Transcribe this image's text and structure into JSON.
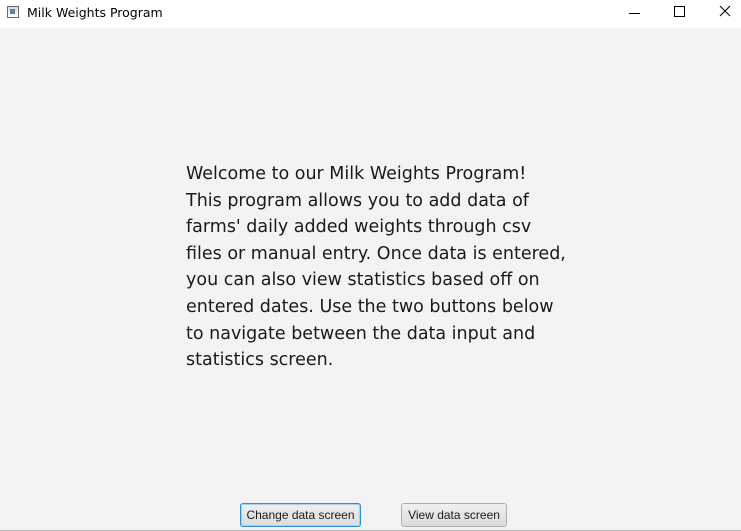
{
  "window": {
    "title": "Milk Weights Program",
    "icons": {
      "app": "app-window-icon",
      "minimize": "minimize-icon",
      "maximize": "maximize-icon",
      "close": "close-icon"
    }
  },
  "main": {
    "welcome_text": "Welcome to our Milk Weights Program! This program allows you to add data of farms' daily added weights through csv files or manual entry. Once data is entered, you can also view statistics based off on entered dates. Use the two buttons below to navigate between the data input and statistics screen."
  },
  "buttons": {
    "change_label": "Change data screen",
    "view_label": "View data screen"
  },
  "colors": {
    "background": "#f3f3f3",
    "focus_border": "#2a8fd6"
  }
}
